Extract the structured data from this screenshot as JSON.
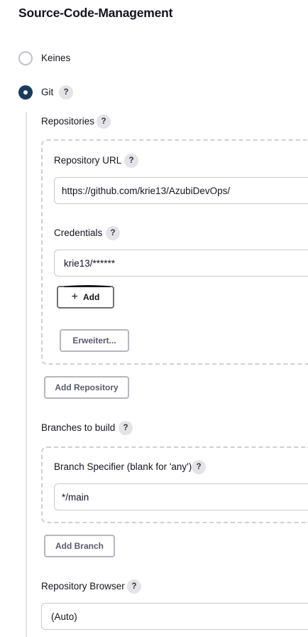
{
  "section": {
    "title": "Source-Code-Management"
  },
  "scm_options": {
    "none_label": "Keines",
    "git_label": "Git",
    "selected": "Git"
  },
  "help_glyph": "?",
  "repositories": {
    "label": "Repositories",
    "repository_url": {
      "label": "Repository URL",
      "value": "https://github.com/krie13/AzubiDevOps/"
    },
    "credentials": {
      "label": "Credentials",
      "value": "krie13/******"
    },
    "add_button": {
      "icon": "plus-icon",
      "glyph": "+",
      "label": "Add"
    },
    "advanced_button": "Erweitert...",
    "add_repository_button": "Add Repository"
  },
  "branches": {
    "label": "Branches to build",
    "specifier": {
      "label": "Branch Specifier (blank for 'any')",
      "value": "*/main"
    },
    "add_branch_button": "Add Branch"
  },
  "repository_browser": {
    "label": "Repository Browser",
    "value": "(Auto)"
  }
}
